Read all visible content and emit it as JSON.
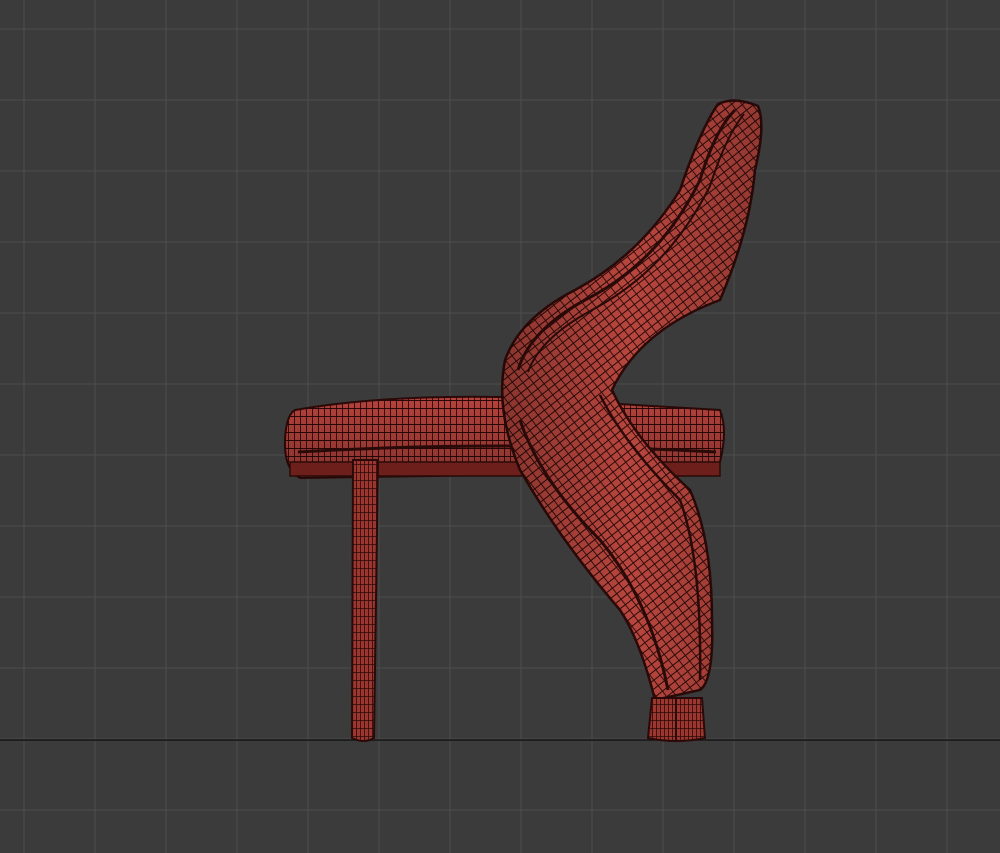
{
  "viewport": {
    "view": "side",
    "background_color": "#3b3b3b",
    "grid_color": "#4c4c4c",
    "ground_line_color": "#141414",
    "grid_visible": true
  },
  "model": {
    "name": "chair",
    "display_mode": "wireframe-on-shaded",
    "surface_color": "#b4423c",
    "wire_color": "#2a0a08",
    "parts": [
      "seat",
      "front-leg",
      "backrest",
      "rear-leg",
      "rear-foot"
    ]
  }
}
